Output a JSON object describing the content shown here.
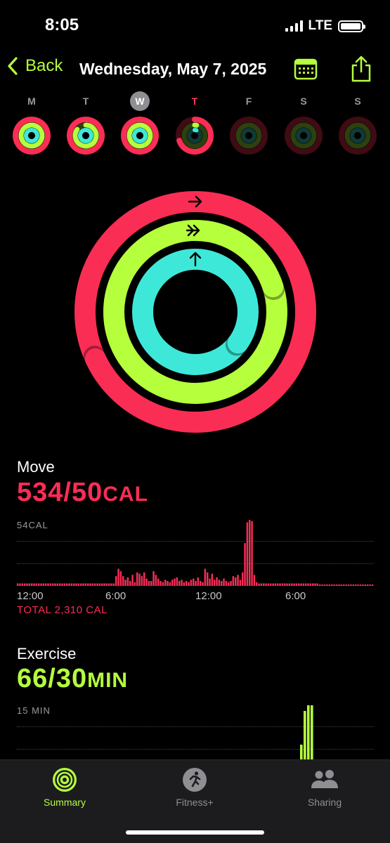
{
  "status": {
    "time": "8:05",
    "network": "LTE",
    "battery_level": 1.0
  },
  "nav": {
    "back_label": "Back",
    "title": "Wednesday, May 7, 2025"
  },
  "week": [
    {
      "letter": "M",
      "state": "past",
      "move": 1.0,
      "exercise": 1.0,
      "stand": 1.0
    },
    {
      "letter": "T",
      "state": "past",
      "move": 1.0,
      "exercise": 0.85,
      "stand": 1.0
    },
    {
      "letter": "W",
      "state": "selected",
      "move": 1.0,
      "exercise": 1.0,
      "stand": 1.0
    },
    {
      "letter": "T",
      "state": "today",
      "move": 0.7,
      "exercise": 0.03,
      "stand": 0.05
    },
    {
      "letter": "F",
      "state": "future",
      "move": 0,
      "exercise": 0,
      "stand": 0
    },
    {
      "letter": "S",
      "state": "future",
      "move": 0,
      "exercise": 0,
      "stand": 0
    },
    {
      "letter": "S",
      "state": "future",
      "move": 0,
      "exercise": 0,
      "stand": 0
    }
  ],
  "rings": {
    "move_progress": 10.68,
    "exercise_progress": 2.2,
    "stand_progress": 1.35,
    "colors": {
      "move": "#fa2d55",
      "exercise": "#b5ff3c",
      "stand": "#3ee8d8"
    }
  },
  "move": {
    "title": "Move",
    "value": "534/50",
    "unit": "CAL",
    "chart_max_label": "54CAL",
    "axis": [
      "12:00",
      "6:00",
      "12:00",
      "6:00"
    ],
    "total": "TOTAL 2,310 CAL"
  },
  "exercise": {
    "title": "Exercise",
    "value": "66/30",
    "unit": "MIN",
    "chart_max_label": "15 MIN"
  },
  "tabs": [
    {
      "label": "Summary",
      "icon": "activity-rings-icon",
      "active": true
    },
    {
      "label": "Fitness+",
      "icon": "runner-icon",
      "active": false
    },
    {
      "label": "Sharing",
      "icon": "people-icon",
      "active": false
    }
  ],
  "chart_data": [
    {
      "type": "bar",
      "title": "Move",
      "ylabel": "CAL",
      "ylim": [
        0,
        54
      ],
      "x_ticks": [
        "12:00",
        "6:00",
        "12:00",
        "6:00"
      ],
      "values": [
        2,
        2,
        2,
        2,
        2,
        2,
        2,
        2,
        2,
        2,
        2,
        2,
        2,
        2,
        2,
        2,
        2,
        2,
        2,
        2,
        2,
        2,
        2,
        2,
        2,
        2,
        2,
        2,
        2,
        2,
        2,
        2,
        2,
        2,
        2,
        2,
        2,
        2,
        2,
        2,
        2,
        2,
        8,
        14,
        12,
        8,
        5,
        7,
        4,
        9,
        3,
        11,
        10,
        8,
        11,
        6,
        4,
        4,
        12,
        9,
        6,
        4,
        3,
        5,
        4,
        3,
        5,
        6,
        7,
        4,
        5,
        3,
        4,
        3,
        5,
        6,
        4,
        7,
        4,
        3,
        14,
        11,
        6,
        10,
        5,
        7,
        5,
        4,
        6,
        4,
        3,
        4,
        8,
        7,
        9,
        5,
        11,
        35,
        52,
        54,
        53,
        9,
        3,
        2,
        2,
        2,
        2,
        2,
        2,
        2,
        2,
        2,
        2,
        2,
        2,
        2,
        2,
        2,
        2,
        2,
        2,
        2,
        2,
        2,
        2,
        2,
        2,
        2,
        2
      ]
    },
    {
      "type": "bar",
      "title": "Exercise",
      "ylabel": "MIN",
      "ylim": [
        0,
        15
      ],
      "values_visible_peaks": [
        8,
        14,
        15,
        15
      ]
    }
  ]
}
